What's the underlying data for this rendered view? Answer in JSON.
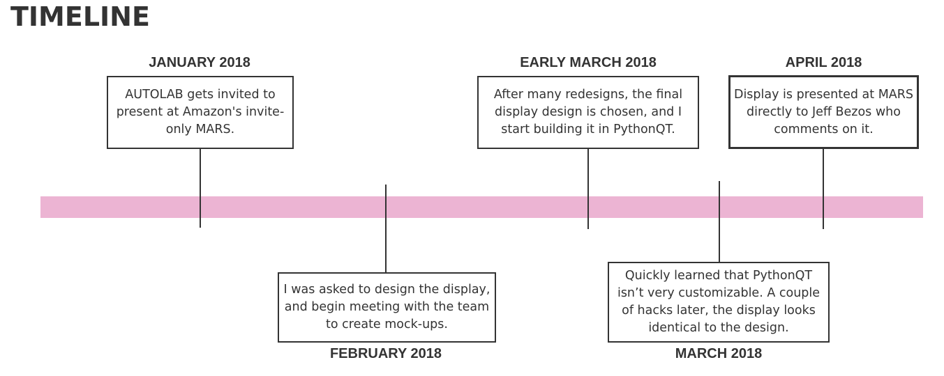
{
  "title": "TIMELINE",
  "colors": {
    "timeline_bar": "#ecb4d3",
    "text": "#333333",
    "border": "#333333"
  },
  "events": [
    {
      "date": "JANUARY 2018",
      "text": "AUTOLAB gets invited to present at Amazon's invite-only MARS.",
      "side": "above"
    },
    {
      "date": "FEBRUARY 2018",
      "text": "I was asked to design the display, and begin meeting with the team to create mock-ups.",
      "side": "below"
    },
    {
      "date": "EARLY MARCH 2018",
      "text": "After many redesigns, the final display design is chosen, and I start  building it in PythonQT.",
      "side": "above"
    },
    {
      "date": "MARCH 2018",
      "text": "Quickly learned that PythonQT isn’t very customizable. A couple of hacks later, the display looks identical to the design.",
      "side": "below"
    },
    {
      "date": "APRIL 2018",
      "text": "Display is presented at MARS directly to Jeff Bezos who comments on it.",
      "side": "above"
    }
  ]
}
